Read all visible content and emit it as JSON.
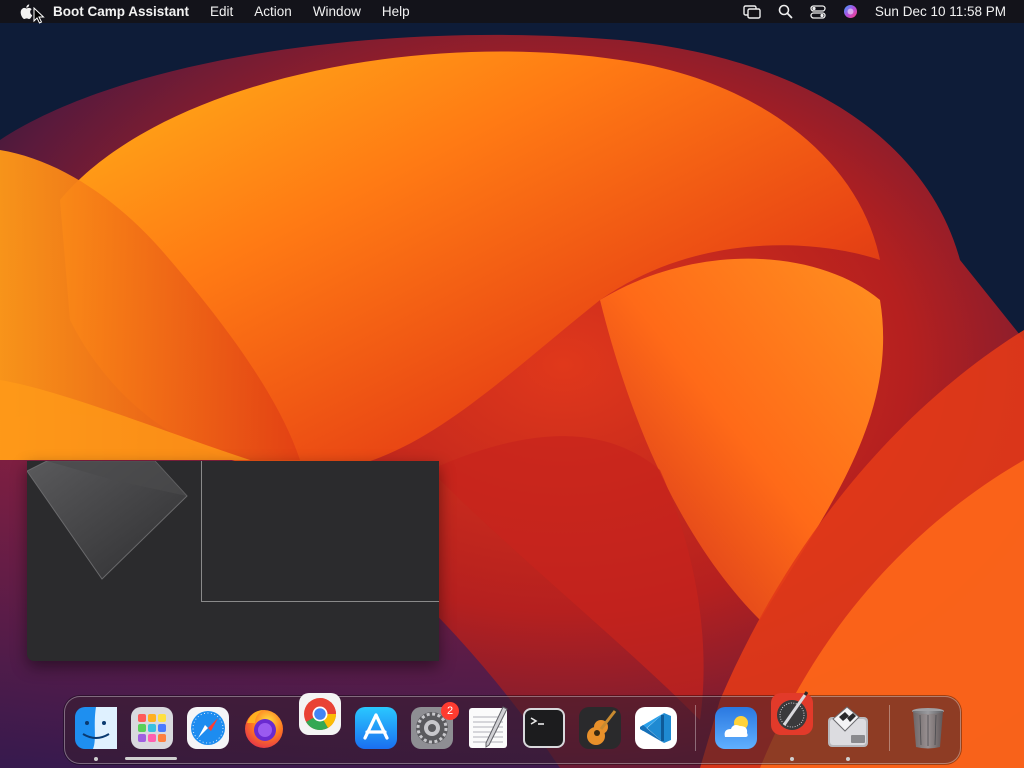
{
  "menubar": {
    "app_name": "Boot Camp Assistant",
    "menus": [
      "Edit",
      "Action",
      "Window",
      "Help"
    ],
    "clock": "Sun Dec 10  11:58 PM",
    "status_icons": [
      "screen-mirroring-icon",
      "spotlight-search-icon",
      "control-center-icon",
      "siri-icon"
    ]
  },
  "dock": {
    "apps": [
      {
        "name": "Finder",
        "icon": "finder-icon",
        "running": true
      },
      {
        "name": "Launchpad",
        "icon": "launchpad-icon",
        "running": false
      },
      {
        "name": "Safari",
        "icon": "safari-icon",
        "running": false
      },
      {
        "name": "Firefox",
        "icon": "firefox-icon",
        "running": false
      },
      {
        "name": "Google Chrome",
        "icon": "chrome-icon",
        "running": false
      },
      {
        "name": "App Store",
        "icon": "app-store-icon",
        "running": false
      },
      {
        "name": "System Settings",
        "icon": "system-settings-icon",
        "running": false,
        "badge": "2"
      },
      {
        "name": "TextEdit",
        "icon": "textedit-icon",
        "running": false
      },
      {
        "name": "Terminal",
        "icon": "terminal-icon",
        "running": false
      },
      {
        "name": "GarageBand",
        "icon": "garageband-icon",
        "running": false
      },
      {
        "name": "Visual Studio Code",
        "icon": "vscode-icon",
        "running": false
      },
      {
        "name": "Weather",
        "icon": "weather-icon",
        "running": false
      },
      {
        "name": "Instruments",
        "icon": "instruments-icon",
        "running": true
      },
      {
        "name": "Boot Camp Assistant",
        "icon": "boot-camp-icon",
        "running": true
      },
      {
        "name": "Trash",
        "icon": "trash-icon",
        "running": false
      }
    ]
  }
}
